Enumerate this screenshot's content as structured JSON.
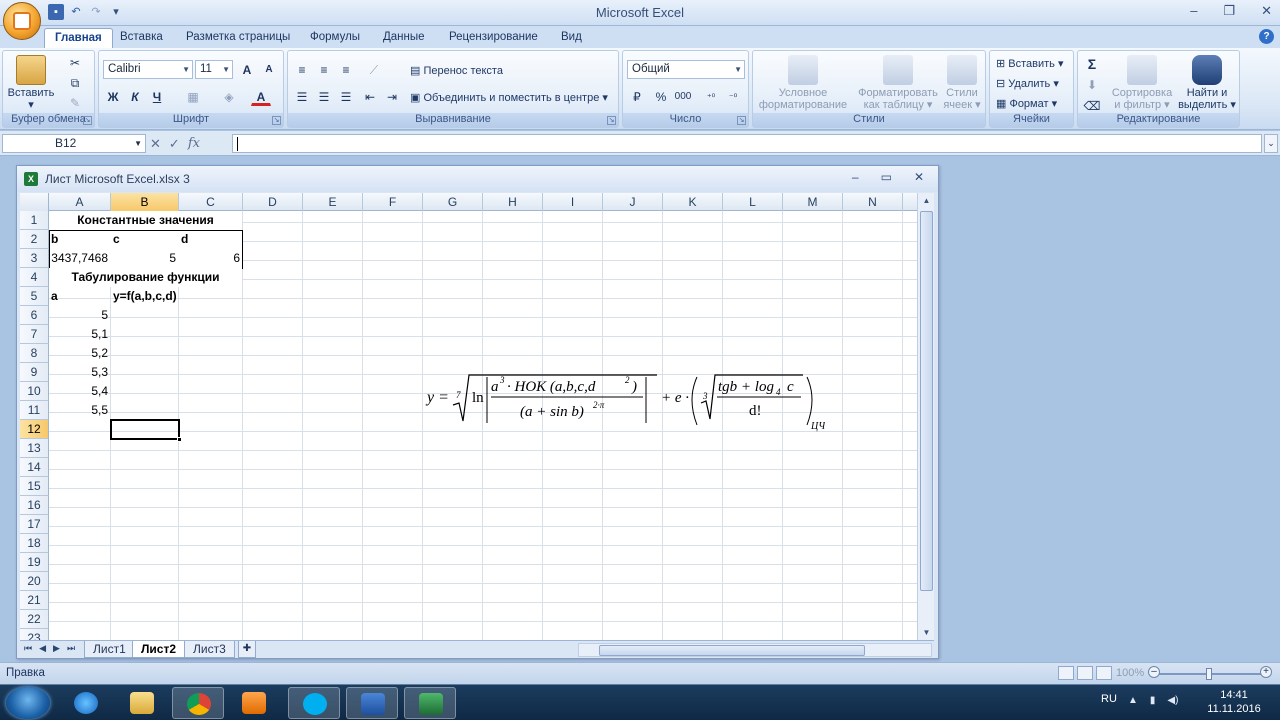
{
  "app": {
    "title": "Microsoft Excel"
  },
  "ribbon_tabs": [
    "Главная",
    "Вставка",
    "Разметка страницы",
    "Формулы",
    "Данные",
    "Рецензирование",
    "Вид"
  ],
  "ribbon": {
    "clipboard": {
      "label": "Буфер обмена",
      "paste": "Вставить"
    },
    "font": {
      "label": "Шрифт",
      "name": "Calibri",
      "size": "11",
      "grow": "A",
      "shrink": "A",
      "bold": "Ж",
      "italic": "К",
      "underline": "Ч",
      "color_letter": "A"
    },
    "alignment": {
      "label": "Выравнивание",
      "wrap": "Перенос текста",
      "merge": "Объединить и поместить в центре"
    },
    "number": {
      "label": "Число",
      "format": "Общий",
      "percent": "%",
      "thousands": "000"
    },
    "styles": {
      "label": "Стили",
      "conditional_1": "Условное",
      "conditional_2": "форматирование",
      "table_1": "Форматировать",
      "table_2": "как таблицу",
      "cell_1": "Стили",
      "cell_2": "ячеек"
    },
    "cells": {
      "label": "Ячейки",
      "insert": "Вставить",
      "delete": "Удалить",
      "format": "Формат"
    },
    "editing": {
      "label": "Редактирование",
      "sort_1": "Сортировка",
      "sort_2": "и фильтр",
      "find_1": "Найти и",
      "find_2": "выделить"
    }
  },
  "formula_bar": {
    "name_box": "B12",
    "value": ""
  },
  "workbook": {
    "title": "Лист Microsoft Excel.xlsx 3"
  },
  "columns": [
    "A",
    "B",
    "C",
    "D",
    "E",
    "F",
    "G",
    "H",
    "I",
    "J",
    "K",
    "L",
    "M",
    "N"
  ],
  "rows": [
    "1",
    "2",
    "3",
    "4",
    "5",
    "6",
    "7",
    "8",
    "9",
    "10",
    "11",
    "12",
    "13",
    "14",
    "15",
    "16",
    "17",
    "18",
    "19",
    "20",
    "21",
    "22",
    "23"
  ],
  "cells": {
    "a1": "Константные значения",
    "a2": "b",
    "b2": "c",
    "c2": "d",
    "a3": "3437,7468",
    "b3": "5",
    "c3": "6",
    "a4": "Табулирование функции",
    "a5": "a",
    "b5": "y=f(a,b,c,d)",
    "a6": "5",
    "a7": "5,1",
    "a8": "5,2",
    "a9": "5,3",
    "a10": "5,4",
    "a11": "5,5"
  },
  "formula_image": {
    "lhs": "y =",
    "root_index_outer": "7",
    "ln": "ln",
    "num_a": "a",
    "num_exp3": "3",
    "num_rest": "· HOK (a,b,c,d",
    "num_exp2": "2",
    "num_close": ")",
    "den": "(a + sin b)",
    "den_exp": "2·π",
    "plus_e": "+ e ·",
    "root_index_inner": "3",
    "inner_num": "tgb + log",
    "log_base": "4",
    "inner_c": "c",
    "inner_den": "d!",
    "subscript": "ЦЧ"
  },
  "sheet_tabs": [
    "Лист1",
    "Лист2",
    "Лист3"
  ],
  "active_sheet": "Лист2",
  "status": {
    "text": "Правка",
    "zoom": "100%"
  },
  "taskbar": {
    "lang": "RU",
    "time": "14:41",
    "date": "11.11.2016"
  }
}
